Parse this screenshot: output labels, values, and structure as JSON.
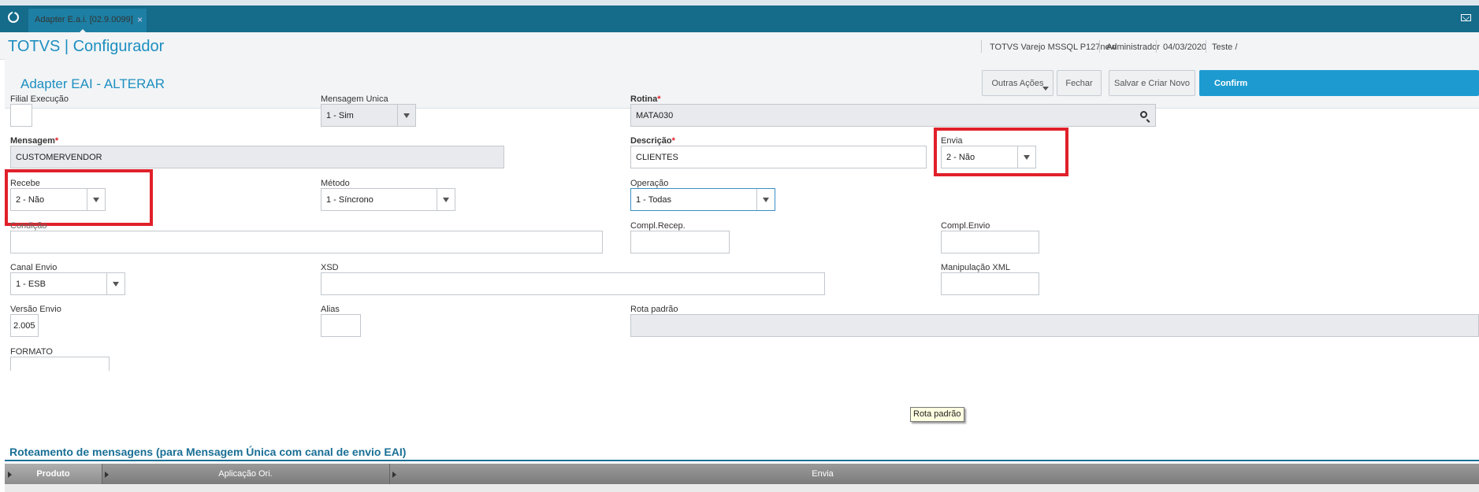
{
  "tab": {
    "label": "Adapter E.a.i. [02.9.0099]",
    "close": "×"
  },
  "app": {
    "title": "TOTVS | Configurador",
    "environment": "TOTVS Varejo MSSQL P127new",
    "user": "Administrador",
    "date": "04/03/2020",
    "company": "Teste /"
  },
  "form": {
    "title": "Adapter EAI - ALTERAR",
    "buttons": {
      "outras": "Outras Ações",
      "fechar": "Fechar",
      "salvar": "Salvar e Criar Novo",
      "confirmar": "Confirm"
    }
  },
  "fields": {
    "filial_execucao": {
      "label": "Filial Execução",
      "value": ""
    },
    "mensagem_unica": {
      "label": "Mensagem Unica",
      "value": "1 - Sim"
    },
    "rotina": {
      "label": "Rotina",
      "req": "*",
      "value": "MATA030"
    },
    "mensagem": {
      "label": "Mensagem",
      "req": "*",
      "value": "CUSTOMERVENDOR"
    },
    "descricao": {
      "label": "Descrição",
      "req": "*",
      "value": "CLIENTES"
    },
    "envia": {
      "label": "Envia",
      "value": "2 - Não"
    },
    "recebe": {
      "label": "Recebe",
      "value": "2 - Não"
    },
    "metodo": {
      "label": "Método",
      "value": "1 - Síncrono"
    },
    "operacao": {
      "label": "Operação",
      "value": "1 - Todas"
    },
    "condicao": {
      "label": "Condição",
      "value": ""
    },
    "compl_recep": {
      "label": "Compl.Recep.",
      "value": ""
    },
    "compl_envio": {
      "label": "Compl.Envio",
      "value": ""
    },
    "canal_envio": {
      "label": "Canal Envio",
      "value": "1 - ESB"
    },
    "xsd": {
      "label": "XSD",
      "value": ""
    },
    "manipulacao_xml": {
      "label": "Manipulação XML",
      "value": ""
    },
    "versao_envio": {
      "label": "Versão Envio",
      "value": "2.005"
    },
    "alias": {
      "label": "Alias",
      "value": ""
    },
    "rota_padrao": {
      "label": "Rota padrão",
      "value": ""
    },
    "formato": {
      "label": "FORMATO",
      "value": ""
    }
  },
  "tooltip": "Rota padrão",
  "grid": {
    "title": "Roteamento de mensagens (para Mensagem Única com canal de envio EAI)",
    "columns": [
      "Produto",
      "Aplicação Ori.",
      "Envia"
    ]
  },
  "colors": {
    "accent": "#1d8fc0",
    "topbar": "#156b8a",
    "highlight": "#e0202a"
  }
}
